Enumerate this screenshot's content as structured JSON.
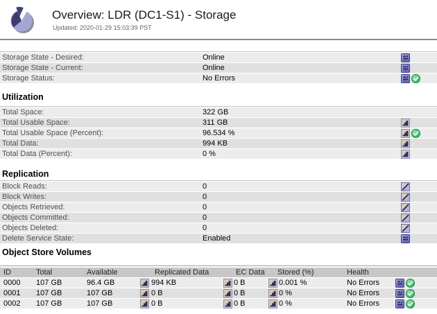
{
  "header": {
    "title": "Overview: LDR (DC1-S1) - Storage",
    "updated": "Updated: 2020-01-29 15:03:39 PST",
    "logo_icon": "pie-chart-logo"
  },
  "colors": {
    "icon_purple": "#7b7bc4",
    "icon_beige": "#d9cbae",
    "row_light": "#ececec",
    "row_dark": "#e0e0e0",
    "table_header_gray": "#c7c7c7",
    "status_green": "#2eb05c",
    "divider_gray": "#8a8a8a"
  },
  "icon_legend": {
    "state": "blue-attribute-state-icon",
    "chart": "chart-history-icon",
    "trend": "trend-delta-icon",
    "check": "green-ok-check-icon"
  },
  "storage_state": {
    "rows": [
      {
        "label": "Storage State - Desired:",
        "value": "Online",
        "icons": [
          "state"
        ]
      },
      {
        "label": "Storage State - Current:",
        "value": "Online",
        "icons": [
          "state"
        ]
      },
      {
        "label": "Storage Status:",
        "value": "No Errors",
        "icons": [
          "state",
          "check"
        ]
      }
    ]
  },
  "utilization": {
    "heading": "Utilization",
    "rows": [
      {
        "label": "Total Space:",
        "value": "322 GB",
        "icons": []
      },
      {
        "label": "Total Usable Space:",
        "value": "311 GB",
        "icons": [
          "chart"
        ]
      },
      {
        "label": "Total Usable Space (Percent):",
        "value": "96.534 %",
        "icons": [
          "chart",
          "check"
        ]
      },
      {
        "label": "Total Data:",
        "value": "994 KB",
        "icons": [
          "chart"
        ]
      },
      {
        "label": "Total Data (Percent):",
        "value": "0 %",
        "icons": [
          "chart"
        ]
      }
    ]
  },
  "replication": {
    "heading": "Replication",
    "rows": [
      {
        "label": "Block Reads:",
        "value": "0",
        "icons": [
          "trend"
        ]
      },
      {
        "label": "Block Writes:",
        "value": "0",
        "icons": [
          "trend"
        ]
      },
      {
        "label": "Objects Retrieved:",
        "value": "0",
        "icons": [
          "trend"
        ]
      },
      {
        "label": "Objects Committed:",
        "value": "0",
        "icons": [
          "trend"
        ]
      },
      {
        "label": "Objects Deleted:",
        "value": "0",
        "icons": [
          "trend"
        ]
      },
      {
        "label": "Delete Service State:",
        "value": "Enabled",
        "icons": [
          "state"
        ]
      }
    ]
  },
  "object_store_volumes": {
    "heading": "Object Store Volumes",
    "columns": [
      "ID",
      "Total",
      "Available",
      "Replicated Data",
      "EC Data",
      "Stored (%)",
      "Health"
    ],
    "rows": [
      {
        "id": "0000",
        "total": "107 GB",
        "available": "96.4 GB",
        "replicated": "994 KB",
        "ec": "0 B",
        "stored": "0.001 %",
        "health": "No Errors"
      },
      {
        "id": "0001",
        "total": "107 GB",
        "available": "107 GB",
        "replicated": "0 B",
        "ec": "0 B",
        "stored": "0 %",
        "health": "No Errors"
      },
      {
        "id": "0002",
        "total": "107 GB",
        "available": "107 GB",
        "replicated": "0 B",
        "ec": "0 B",
        "stored": "0 %",
        "health": "No Errors"
      }
    ]
  }
}
